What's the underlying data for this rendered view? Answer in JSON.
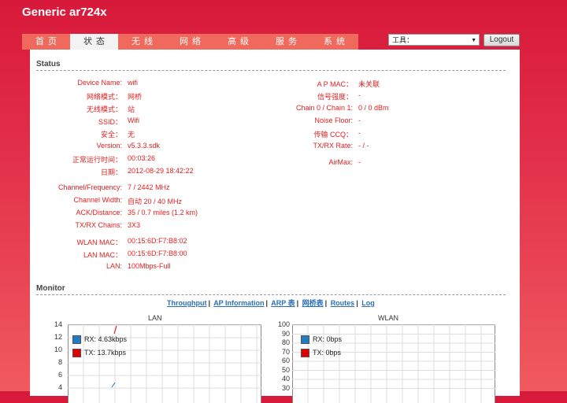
{
  "brand": "Generic ar724x",
  "nav": [
    {
      "label": "首页",
      "active": false
    },
    {
      "label": "状态",
      "active": true
    },
    {
      "label": "无线",
      "active": false
    },
    {
      "label": "网络",
      "active": false
    },
    {
      "label": "高级",
      "active": false
    },
    {
      "label": "服务",
      "active": false
    },
    {
      "label": "系统",
      "active": false
    }
  ],
  "tools": {
    "selected": "工具："
  },
  "logout": "Logout",
  "status": {
    "title": "Status",
    "left": [
      {
        "label": "Device Name:",
        "value": "wifi"
      },
      {
        "label": "网络模式：",
        "value": "网桥"
      },
      {
        "label": "无线模式：",
        "value": "站"
      },
      {
        "label": "SSID：",
        "value": "Wifi"
      },
      {
        "label": "安全：",
        "value": "无"
      },
      {
        "label": "Version:",
        "value": "v5.3.3.sdk"
      },
      {
        "label": "正常运行时间：",
        "value": "00:03:26"
      },
      {
        "label": "日期：",
        "value": "2012-08-29 18:42:22"
      },
      {
        "label": "Channel/Frequency:",
        "value": "7 / 2442 MHz"
      },
      {
        "label": "Channel Width:",
        "value": "自动 20 / 40 MHz"
      },
      {
        "label": "ACK/Distance:",
        "value": "35 / 0.7 miles (1.2 km)"
      },
      {
        "label": "TX/RX Chains:",
        "value": "3X3"
      },
      {
        "label": "WLAN MAC：",
        "value": "00:15:6D:F7:B8:02"
      },
      {
        "label": "LAN MAC：",
        "value": "00:15:6D:F7:B8:00"
      },
      {
        "label": "LAN:",
        "value": "100Mbps-Full"
      }
    ],
    "right": [
      {
        "label": "A P MAC：",
        "value": "未关联"
      },
      {
        "label": "信号强度：",
        "value": "-"
      },
      {
        "label": "Chain 0 / Chain 1:",
        "value": "0 / 0 dBm"
      },
      {
        "label": "Noise Floor:",
        "value": "-"
      },
      {
        "label": "传输 CCQ：",
        "value": "-"
      },
      {
        "label": "TX/RX Rate:",
        "value": "- / -"
      },
      {
        "label": "AirMax:",
        "value": "-"
      }
    ]
  },
  "monitor": {
    "title": "Monitor",
    "links": [
      "Throughput",
      "AP Information",
      "ARP 表",
      "网桥表",
      "Routes",
      "Log"
    ],
    "lan_chart": {
      "title": "LAN",
      "y_ticks": [
        "14",
        "12",
        "10",
        "8",
        "6",
        "4"
      ],
      "legend": [
        {
          "label": "RX: 4.63kbps",
          "color": "#1f7bc4"
        },
        {
          "label": "TX: 13.7kbps",
          "color": "#e00000"
        }
      ]
    },
    "wlan_chart": {
      "title": "WLAN",
      "y_ticks": [
        "100",
        "90",
        "80",
        "70",
        "60",
        "50",
        "40",
        "30"
      ],
      "legend": [
        {
          "label": "RX: 0bps",
          "color": "#1f7bc4"
        },
        {
          "label": "TX: 0bps",
          "color": "#e00000"
        }
      ]
    }
  }
}
